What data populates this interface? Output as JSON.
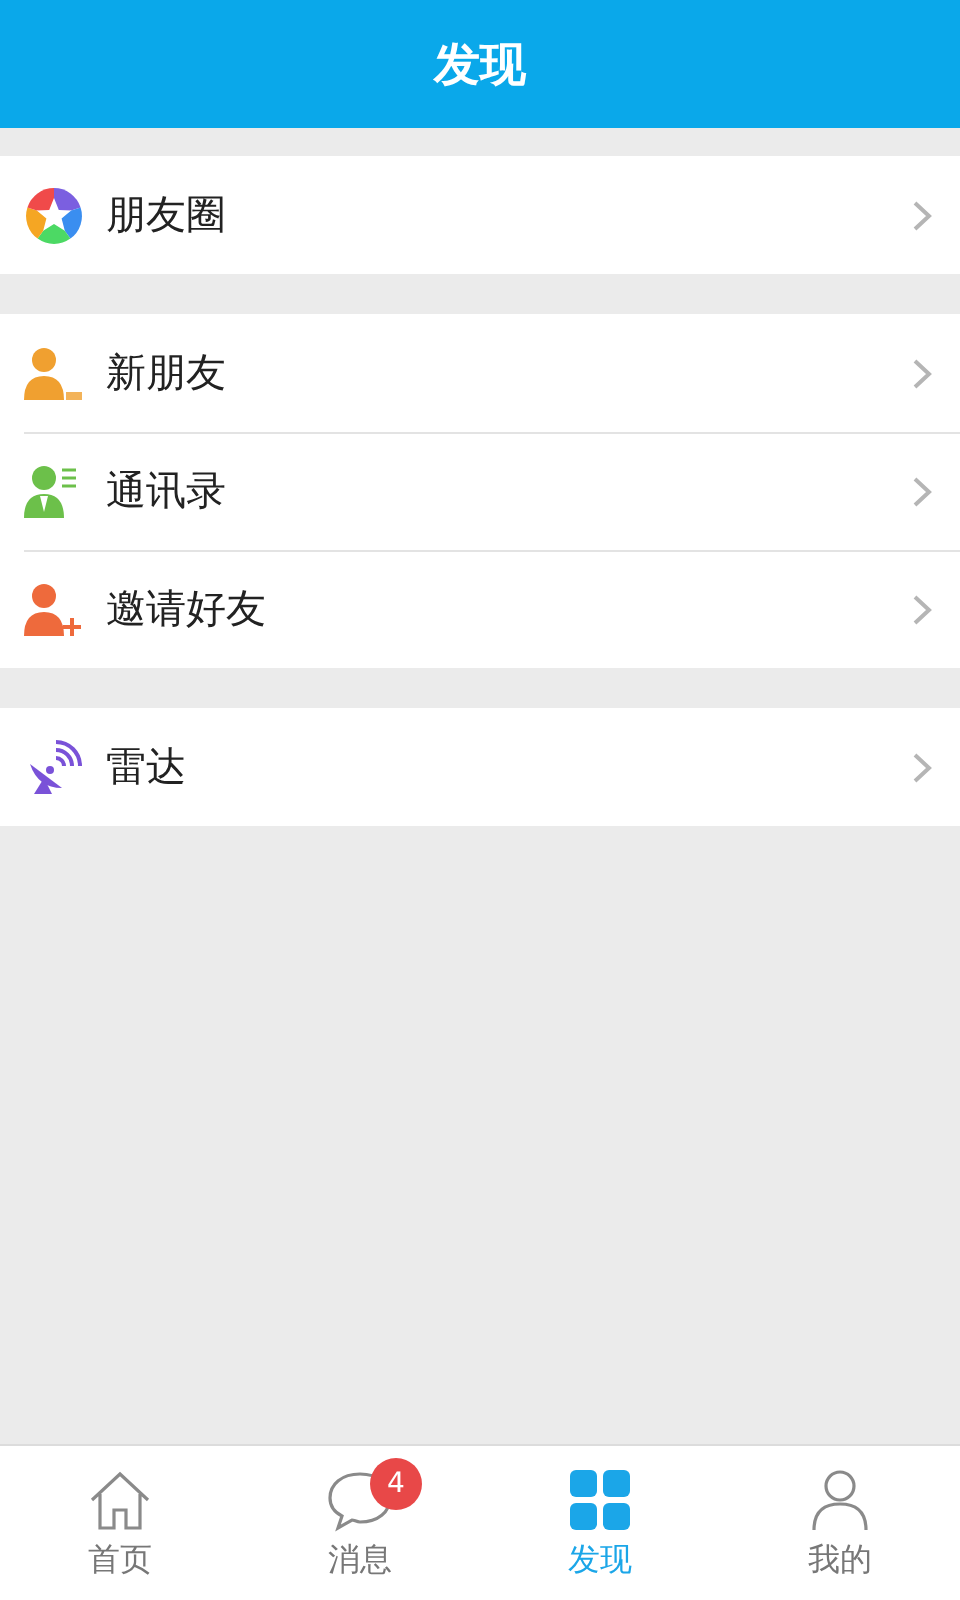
{
  "header": {
    "title": "发现"
  },
  "groups": [
    {
      "items": [
        {
          "label": "朋友圈",
          "kind": "moments"
        }
      ]
    },
    {
      "items": [
        {
          "label": "新朋友",
          "kind": "new-friend"
        },
        {
          "label": "通讯录",
          "kind": "contacts"
        },
        {
          "label": "邀请好友",
          "kind": "invite"
        }
      ]
    },
    {
      "items": [
        {
          "label": "雷达",
          "kind": "radar"
        }
      ]
    }
  ],
  "tabs": [
    {
      "label": "首页",
      "kind": "home",
      "selected": false
    },
    {
      "label": "消息",
      "kind": "messages",
      "selected": false,
      "badge": "4"
    },
    {
      "label": "发现",
      "kind": "discover",
      "selected": true
    },
    {
      "label": "我的",
      "kind": "profile",
      "selected": false
    }
  ]
}
